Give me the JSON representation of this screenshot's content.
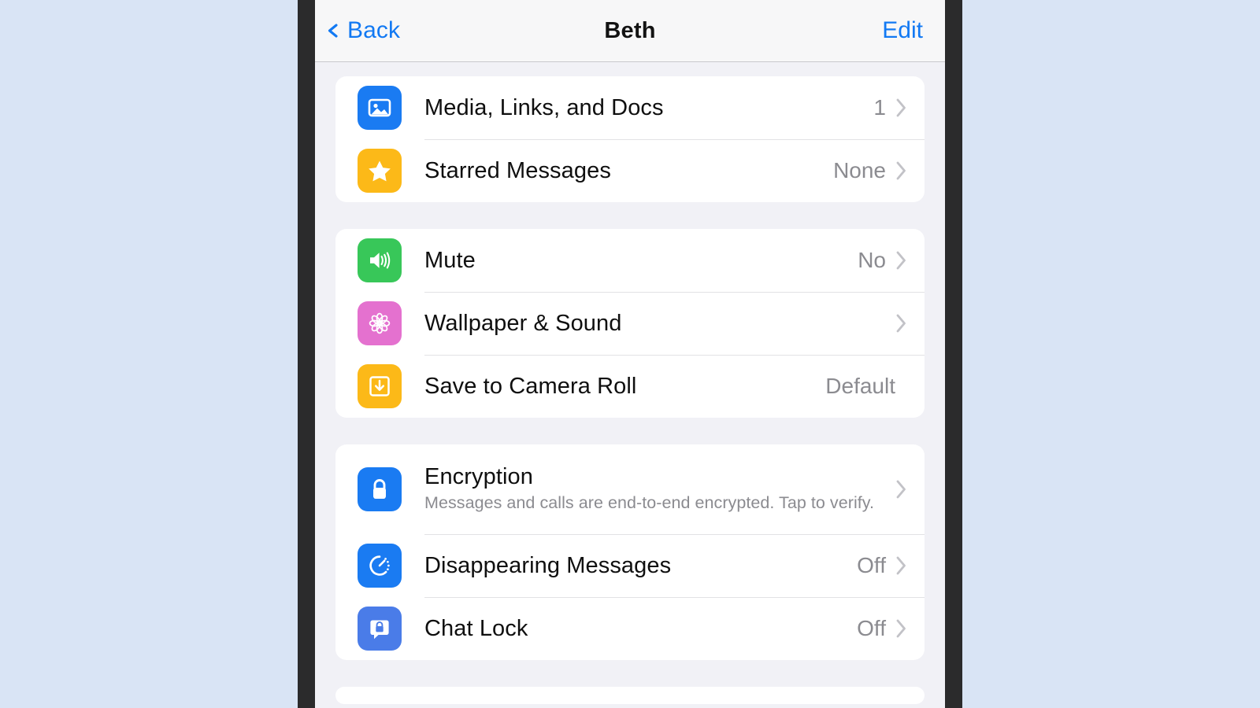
{
  "navbar": {
    "back_label": "Back",
    "title": "Beth",
    "edit_label": "Edit",
    "accent_color": "#1279f3"
  },
  "groups": [
    {
      "rows": [
        {
          "icon": "photo-icon",
          "icon_color": "#1a7bf2",
          "title": "Media, Links, and Docs",
          "value": "1",
          "chevron": true
        },
        {
          "icon": "star-icon",
          "icon_color": "#fcb918",
          "title": "Starred Messages",
          "value": "None",
          "chevron": true
        }
      ]
    },
    {
      "rows": [
        {
          "icon": "speaker-icon",
          "icon_color": "#38c759",
          "title": "Mute",
          "value": "No",
          "chevron": true
        },
        {
          "icon": "rosette-icon",
          "icon_color": "#e471cf",
          "title": "Wallpaper & Sound",
          "value": "",
          "chevron": true
        },
        {
          "icon": "download-tray-icon",
          "icon_color": "#fcb918",
          "title": "Save to Camera Roll",
          "value": "Default",
          "chevron": false
        }
      ]
    },
    {
      "rows": [
        {
          "icon": "lock-icon",
          "icon_color": "#1a7bf2",
          "title": "Encryption",
          "subtitle": "Messages and calls are end-to-end encrypted. Tap to verify.",
          "value": "",
          "chevron": true
        },
        {
          "icon": "timer-icon",
          "icon_color": "#1a7bf2",
          "title": "Disappearing Messages",
          "value": "Off",
          "chevron": true
        },
        {
          "icon": "chat-lock-icon",
          "icon_color": "#4a7ce8",
          "title": "Chat Lock",
          "value": "Off",
          "chevron": true
        }
      ]
    }
  ]
}
